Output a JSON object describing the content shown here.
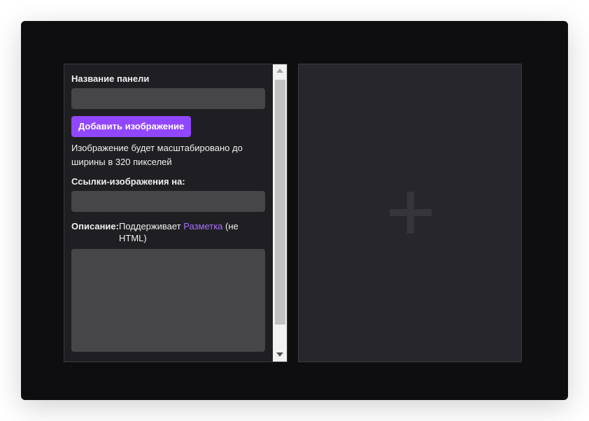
{
  "panel_form": {
    "title_label": "Название панели",
    "title_value": "",
    "add_image_button": "Добавить изображение",
    "image_help": "Изображение будет масштабировано до ширины в 320 пикселей",
    "link_label": "Ссылки-изображения на:",
    "link_value": "",
    "description_label": "Описание:",
    "description_hint_before": "Поддерживает ",
    "description_hint_link": "Разметка",
    "description_hint_after": " (не HTML)",
    "description_value": ""
  },
  "preview": {
    "icon": "plus-icon"
  },
  "colors": {
    "accent": "#9147ff",
    "link": "#a970ff",
    "background": "#0e0e10",
    "panel": "#1f1f23",
    "input": "#464649"
  }
}
